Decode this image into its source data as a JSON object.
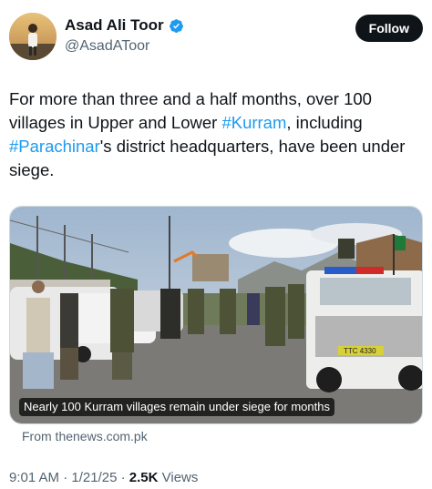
{
  "author": {
    "display_name": "Asad Ali Toor",
    "handle": "@AsadAToor",
    "verified_icon": "verified-badge-icon",
    "avatar_icon": "avatar"
  },
  "follow_label": "Follow",
  "tweet": {
    "text_1": "For more than three and a half months, over 100 villages in Upper and Lower ",
    "hashtag_1": "#Kurram",
    "text_2": ", including ",
    "hashtag_2": "#Parachinar",
    "text_3": "'s district headquarters, have been under siege."
  },
  "card": {
    "caption": "Nearly 100 Kurram villages remain under siege for months",
    "source": "From thenews.com.pk",
    "vehicle_plate": "TTC 4330"
  },
  "meta": {
    "time": "9:01 AM",
    "sep1": " · ",
    "date": "1/21/25",
    "sep2": " · ",
    "views_count": "2.5K",
    "views_label": " Views"
  },
  "colors": {
    "accent": "#1d9bf0",
    "text": "#0f1419",
    "muted": "#536471"
  }
}
